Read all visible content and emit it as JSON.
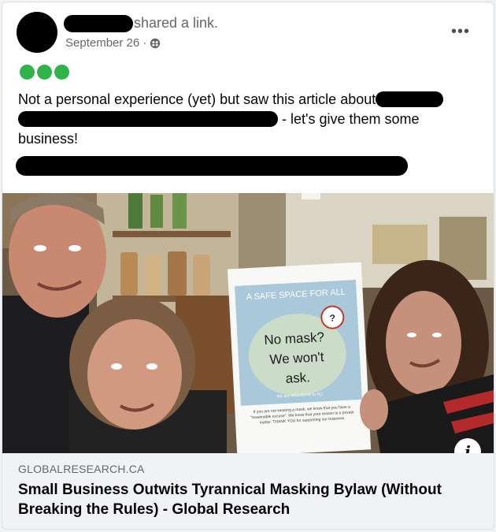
{
  "post": {
    "action_text": "shared a link.",
    "date": "September 26 ·",
    "privacy_icon": "friends-icon",
    "more_label": "•••",
    "text_part1": "Not a personal experience (yet) but saw this article about",
    "text_part2": "- let's give them some business!"
  },
  "sign": {
    "banner": "A SAFE SPACE FOR ALL",
    "line1": "No mask?",
    "line2": "We won't",
    "line3": "ask.",
    "small_text": "We are INCLUSIVE to ALL",
    "fine_print": "If you are not wearing a mask, we know that you have a \"reasonable excuse\". We know that your reason is a private matter. THANK YOU for supporting our business."
  },
  "link": {
    "domain": "GLOBALRESEARCH.CA",
    "title": "Small Business Outwits Tyrannical Masking Bylaw (Without Breaking the Rules) - Global Research",
    "info_label": "i"
  },
  "colors": {
    "dot_green": "#2fb34a",
    "text": "#050505",
    "secondary": "#65676b",
    "link_bg": "#f0f2f5"
  }
}
